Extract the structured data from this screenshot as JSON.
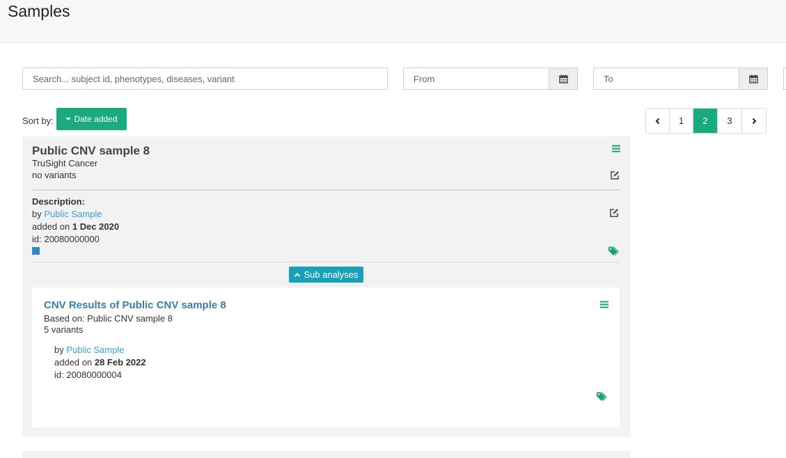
{
  "header": {
    "title": "Samples"
  },
  "filters": {
    "search_placeholder": "Search... subject id, phenotypes, diseases, variant",
    "from_placeholder": "From",
    "to_placeholder": "To"
  },
  "sort": {
    "label": "Sort by:",
    "button": "Date added"
  },
  "pagination": {
    "prev_icon": "chevron-left-icon",
    "pages": [
      "1",
      "2",
      "3"
    ],
    "active_page": "2",
    "next_icon": "chevron-right-icon"
  },
  "sample": {
    "title": "Public CNV sample 8",
    "panel": "TruSight Cancer",
    "variants": "no variants",
    "description_label": "Description:",
    "by_prefix": "by",
    "owner": "Public Sample",
    "added_prefix": "added on",
    "added_date": "1 Dec 2020",
    "id_text": "id: 20080000000",
    "sub_analyses_button": "Sub analyses",
    "colors": {
      "accent": "#1aaa80",
      "sub_button": "#1aa1b8",
      "square": "#2f88c0",
      "link": "#3a9fd8"
    }
  },
  "analysis": {
    "title": "CNV Results of Public CNV sample 8",
    "based_on": "Based on: Public CNV sample 8",
    "variants": "5 variants",
    "by_prefix": "by",
    "owner": "Public Sample",
    "added_prefix": "added on",
    "added_date": "28 Feb 2022",
    "id_text": "id: 20080000004"
  }
}
